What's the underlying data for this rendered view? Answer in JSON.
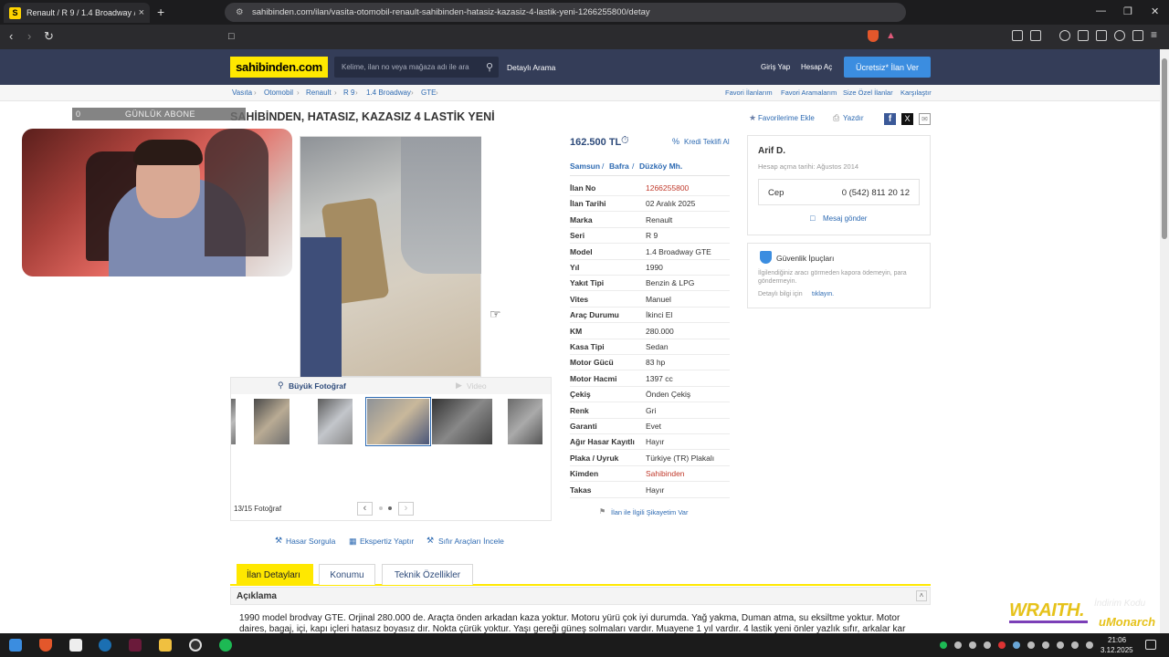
{
  "browser": {
    "tab_title": "Renault / R 9 / 1.4 Broadway / GTE",
    "tab_favicon": "S",
    "url": "sahibinden.com/ilan/vasita-otomobil-renault-sahibinden-hatasiz-kazasiz-4-lastik-yeni-1266255800/detay",
    "new_tab": "+",
    "close_tab": "×"
  },
  "site": {
    "logo": "sahibinden.com",
    "search_placeholder": "Kelime, ilan no veya mağaza adı ile ara",
    "detailed_search": "Detaylı Arama",
    "login": "Giriş Yap",
    "register": "Hesap Aç",
    "post_ad": "Ücretsiz* İlan Ver"
  },
  "breadcrumb": [
    "Vasıta",
    "Otomobil",
    "Renault",
    "R 9",
    "1.4 Broadway",
    "GTE"
  ],
  "crumb_right": [
    "Favori İlanlarım",
    "Favori Aramalarım",
    "Size Özel İlanlar",
    "Karşılaştır"
  ],
  "overlay": {
    "count": "0",
    "label": "GÜNLÜK ABONE"
  },
  "listing": {
    "title": "SAHİBİNDEN, HATASIZ, KAZASIZ 4 LASTİK YENİ",
    "favorite": "Favorilerime Ekle",
    "print": "Yazdır",
    "price": "162.500 TL",
    "credit": "Kredi Teklifi Al",
    "location": [
      "Samsun",
      "Bafra",
      "Düzköy Mh."
    ],
    "details": [
      {
        "label": "İlan No",
        "value": "1266255800",
        "highlight": true
      },
      {
        "label": "İlan Tarihi",
        "value": "02 Aralık 2025"
      },
      {
        "label": "Marka",
        "value": "Renault"
      },
      {
        "label": "Seri",
        "value": "R 9"
      },
      {
        "label": "Model",
        "value": "1.4 Broadway GTE"
      },
      {
        "label": "Yıl",
        "value": "1990"
      },
      {
        "label": "Yakıt Tipi",
        "value": "Benzin & LPG"
      },
      {
        "label": "Vites",
        "value": "Manuel"
      },
      {
        "label": "Araç Durumu",
        "value": "İkinci El"
      },
      {
        "label": "KM",
        "value": "280.000"
      },
      {
        "label": "Kasa Tipi",
        "value": "Sedan"
      },
      {
        "label": "Motor Gücü",
        "value": "83 hp"
      },
      {
        "label": "Motor Hacmi",
        "value": "1397 cc"
      },
      {
        "label": "Çekiş",
        "value": "Önden Çekiş"
      },
      {
        "label": "Renk",
        "value": "Gri"
      },
      {
        "label": "Garanti",
        "value": "Evet"
      },
      {
        "label": "Ağır Hasar Kayıtlı",
        "value": "Hayır"
      },
      {
        "label": "Plaka / Uyruk",
        "value": "Türkiye (TR) Plakalı"
      },
      {
        "label": "Kimden",
        "value": "Sahibinden",
        "highlight": true
      },
      {
        "label": "Takas",
        "value": "Hayır"
      }
    ],
    "complaint": "İlan ile İlgili Şikayetim Var"
  },
  "gallery": {
    "big_photo": "Büyük Fotoğraf",
    "video": "Video",
    "counter": "13/15 Fotoğraf",
    "prev": "‹",
    "next": "›"
  },
  "seller": {
    "name": "Arif D.",
    "since": "Hesap açma tarihi: Ağustos 2014",
    "phone_label": "Cep",
    "phone": "0 (542) 811 20 12",
    "message": "Mesaj gönder"
  },
  "safety": {
    "title": "Güvenlik İpuçları",
    "text": "İlgilendiğiniz aracı görmeden kapora ödemeyin, para göndermeyin.",
    "more_prefix": "Detaylı bilgi için",
    "more_link": "tıklayın."
  },
  "actions": [
    "Hasar Sorgula",
    "Ekspertiz Yaptır",
    "Sıfır Araçları İncele"
  ],
  "tabs": [
    "İlan Detayları",
    "Konumu",
    "Teknik Özellikler"
  ],
  "description": {
    "header": "Açıklama",
    "text": "1990 model brodvay GTE. Orjinal 280.000 de. Araçta önden arkadan kaza yoktur. Motoru yürü çok iyi durumda. Yağ yakma, Duman atma, su eksiltme yoktur. Motor daires, bagaj, içi, kapı içleri hatasız boyasız dır. Nokta çürük yoktur. Yaşı gereği güneş solmaları vardır. Muayene 1 yıl vardır. 4 lastik yeni önler yazlık sıfır, arkalar kar"
  },
  "watermark": {
    "brand": "WRAITH.",
    "sub": "uMonarch",
    "small": "İndirim Kodu"
  },
  "taskbar": {
    "time": "21:06",
    "date": "3.12.2025"
  },
  "colors": {
    "accent_yellow": "#ffe800",
    "header_bg": "#343d58",
    "link_blue": "#2d6ab2",
    "highlight_red": "#c0392b"
  }
}
